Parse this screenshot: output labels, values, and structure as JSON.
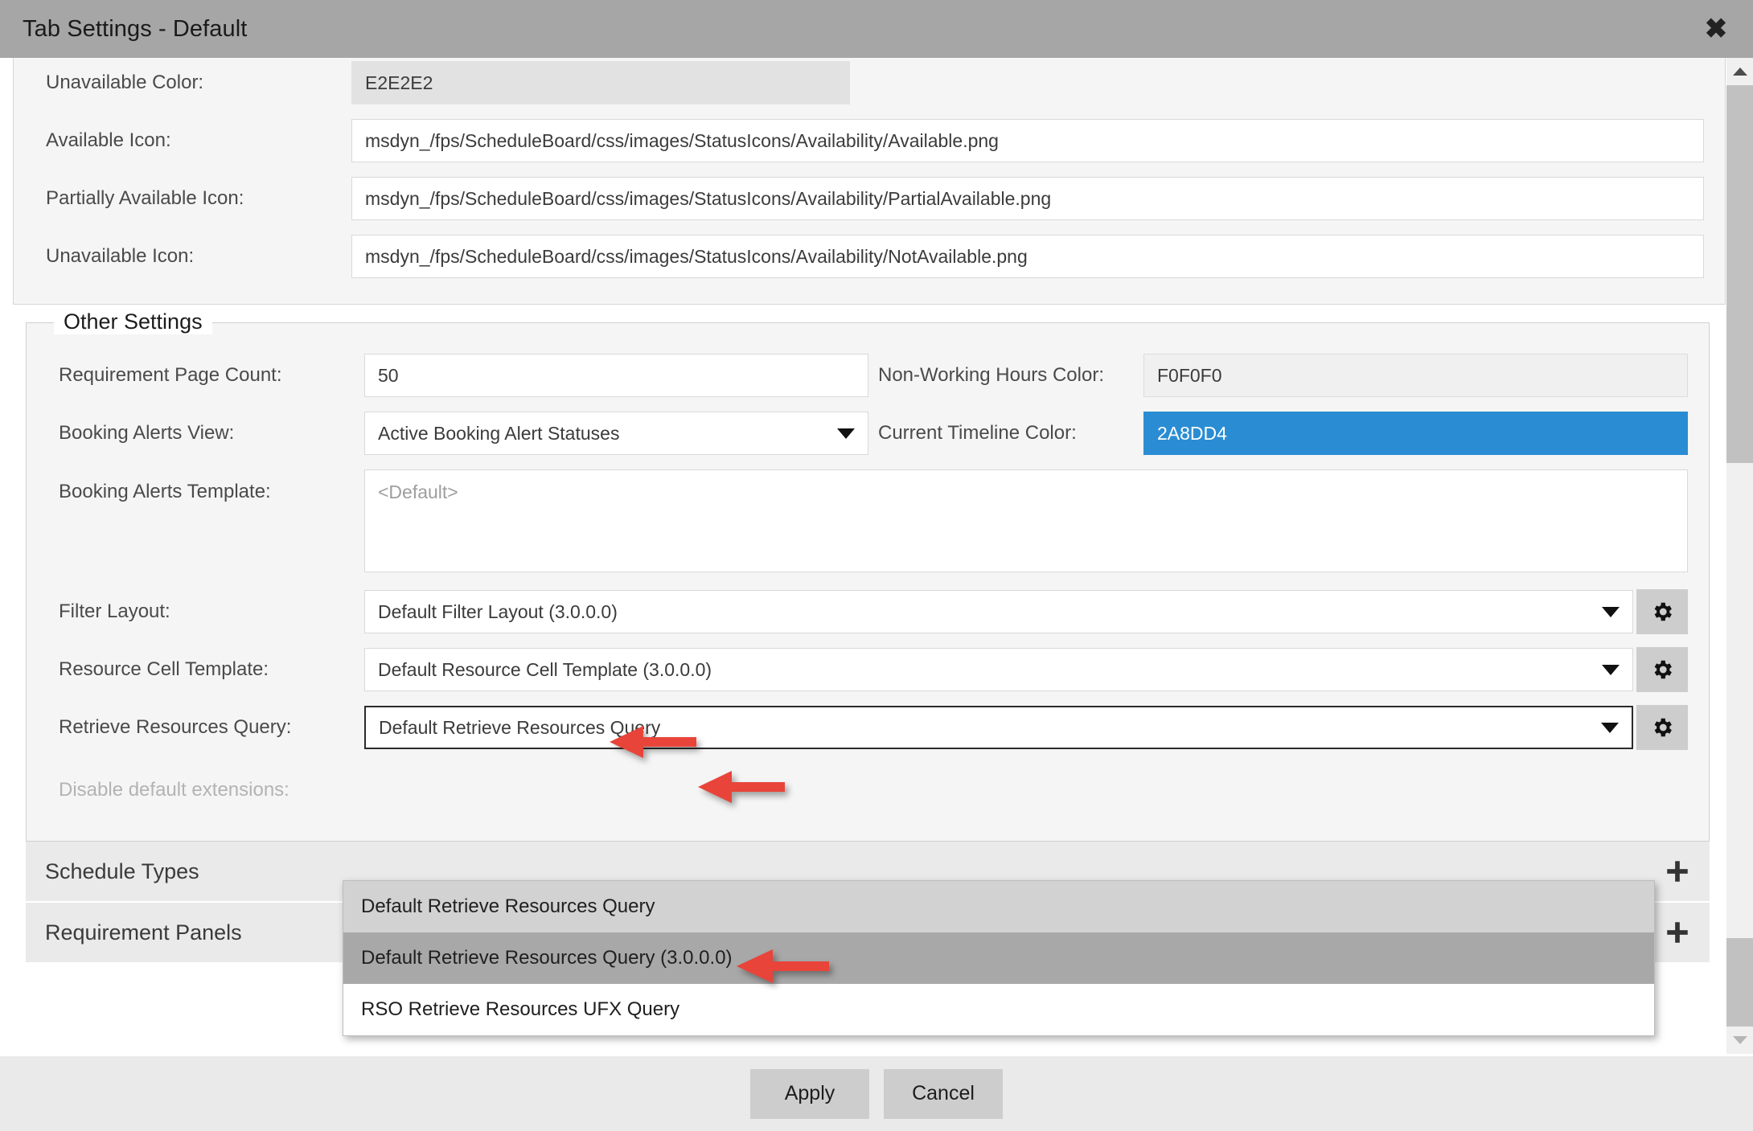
{
  "window": {
    "title": "Tab Settings - Default",
    "close_icon": "close-icon"
  },
  "availability_section": {
    "rows": [
      {
        "label": "Unavailable Color:",
        "value": "E2E2E2",
        "type": "color-swatch",
        "swatch_hex": "#E2E2E2",
        "text_hex": "#3b3b3b"
      },
      {
        "label": "Available Icon:",
        "value": "msdyn_/fps/ScheduleBoard/css/images/StatusIcons/Availability/Available.png",
        "type": "text"
      },
      {
        "label": "Partially Available Icon:",
        "value": "msdyn_/fps/ScheduleBoard/css/images/StatusIcons/Availability/PartialAvailable.png",
        "type": "text"
      },
      {
        "label": "Unavailable Icon:",
        "value": "msdyn_/fps/ScheduleBoard/css/images/StatusIcons/Availability/NotAvailable.png",
        "type": "text"
      }
    ]
  },
  "other_settings": {
    "legend": "Other Settings",
    "requirement_page_count": {
      "label": "Requirement Page Count:",
      "value": "50"
    },
    "non_working_hours_color": {
      "label": "Non-Working Hours Color:",
      "value": "F0F0F0",
      "swatch_hex": "#F0F0F0",
      "text_hex": "#3b3b3b"
    },
    "booking_alerts_view": {
      "label": "Booking Alerts View:",
      "value": "Active Booking Alert Statuses"
    },
    "current_timeline_color": {
      "label": "Current Timeline Color:",
      "value": "2A8DD4",
      "swatch_hex": "#2A8DD4",
      "text_hex": "#ffffff"
    },
    "booking_alerts_template": {
      "label": "Booking Alerts Template:",
      "placeholder": "<Default>"
    },
    "filter_layout": {
      "label": "Filter Layout:",
      "value": "Default Filter Layout (3.0.0.0)",
      "gear_icon": "gear-icon"
    },
    "resource_cell_template": {
      "label": "Resource Cell Template:",
      "value": "Default Resource Cell Template (3.0.0.0)",
      "gear_icon": "gear-icon"
    },
    "retrieve_resources_query": {
      "label": "Retrieve Resources Query:",
      "value": "Default Retrieve Resources Query",
      "gear_icon": "gear-icon"
    },
    "disable_default_extensions": {
      "label": "Disable default extensions:"
    }
  },
  "dropdown": {
    "options": [
      {
        "label": "Default Retrieve Resources Query",
        "state": "hover"
      },
      {
        "label": "Default Retrieve Resources Query (3.0.0.0)",
        "state": "selected"
      },
      {
        "label": "RSO Retrieve Resources UFX Query",
        "state": "normal"
      }
    ]
  },
  "sections": [
    {
      "title": "Schedule Types",
      "add_icon": "plus-icon"
    },
    {
      "title": "Requirement Panels",
      "add_icon": "plus-icon"
    }
  ],
  "footer": {
    "apply_label": "Apply",
    "cancel_label": "Cancel"
  },
  "annotations": {
    "arrow_color": "#E8443A",
    "arrows": [
      {
        "name": "arrow-filter-layout",
        "target": "Filter Layout:"
      },
      {
        "name": "arrow-resource-cell-template",
        "target": "Resource Cell Template:"
      },
      {
        "name": "arrow-dropdown-option-selected",
        "target": "Default Retrieve Resources Query (3.0.0.0)"
      }
    ]
  },
  "scrollbar": {
    "up_icon": "chevron-up-icon",
    "down_icon": "chevron-down-icon"
  }
}
